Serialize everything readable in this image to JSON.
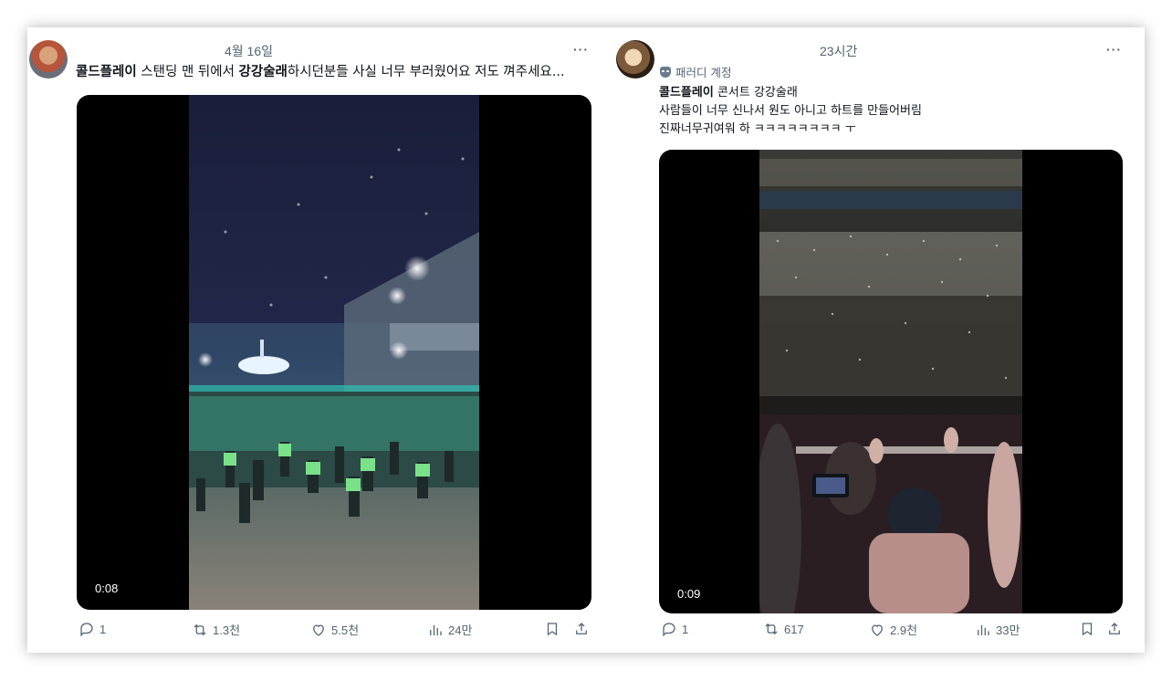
{
  "posts": [
    {
      "timestamp": "4월 16일",
      "more": "···",
      "text_parts": {
        "b1": "콜드플레이",
        "t1": " 스탠딩 맨 뒤에서 ",
        "b2": "강강술래",
        "t2": "하시던분들 사실 너무 부러웠어요 저도 껴주세요..."
      },
      "video": {
        "duration": "0:08"
      },
      "actions": {
        "replies": "1",
        "reposts": "1.3천",
        "likes": "5.5천",
        "views": "24만"
      },
      "avatar_icon": "profile-avatar"
    },
    {
      "timestamp": "23시간",
      "more": "···",
      "parody_label": "패러디 계정",
      "text_lines": {
        "line1_bold": "콜드플레이",
        "line1_rest": " 콘서트 강강술래",
        "line2": "사람들이 너무 신나서 원도 아니고 하트를 만들어버림",
        "line3": "진짜너무귀여워 하 ㅋㅋㅋㅋㅋㅋㅋㅋ ㅜ"
      },
      "video": {
        "duration": "0:09"
      },
      "actions": {
        "replies": "1",
        "reposts": "617",
        "likes": "2.9천",
        "views": "33만"
      },
      "avatar_icon": "profile-avatar"
    }
  ],
  "icons": {
    "reply": "reply-icon",
    "repost": "repost-icon",
    "like": "heart-icon",
    "views": "views-icon",
    "bookmark": "bookmark-icon",
    "share": "share-icon",
    "parody": "parody-mask-icon"
  },
  "colors": {
    "text_primary": "#0f1419",
    "text_secondary": "#536471",
    "media_bg": "#000000"
  }
}
